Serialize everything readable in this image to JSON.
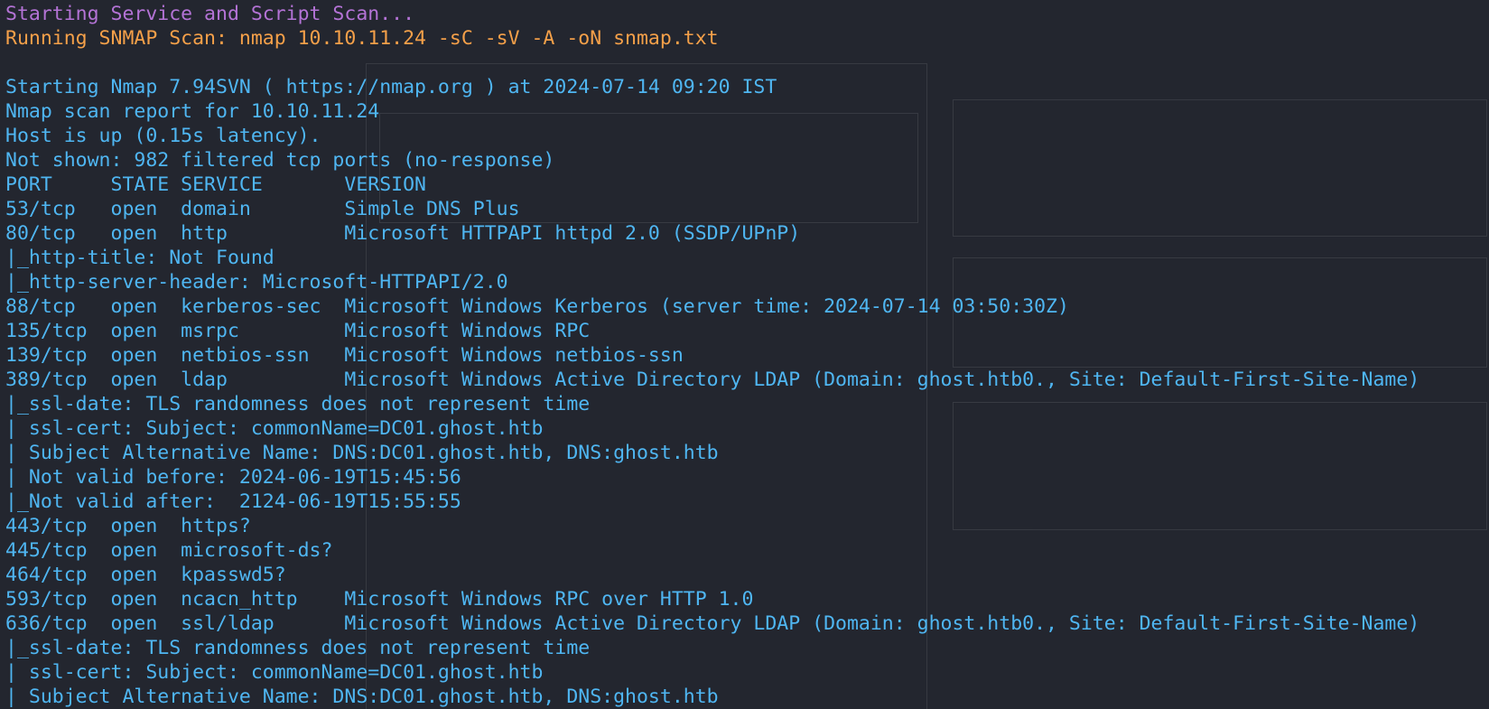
{
  "terminal": {
    "lines": [
      {
        "text": "Starting Service and Script Scan...",
        "color": "#b473d6"
      },
      {
        "text": "Running SNMAP Scan: nmap 10.10.11.24 -sC -sV -A -oN snmap.txt",
        "color": "#f5a049"
      },
      {
        "text": "",
        "color": "#4fb6f2"
      },
      {
        "text": "Starting Nmap 7.94SVN ( https://nmap.org ) at 2024-07-14 09:20 IST",
        "color": "#4fb6f2"
      },
      {
        "text": "Nmap scan report for 10.10.11.24",
        "color": "#4fb6f2"
      },
      {
        "text": "Host is up (0.15s latency).",
        "color": "#4fb6f2"
      },
      {
        "text": "Not shown: 982 filtered tcp ports (no-response)",
        "color": "#4fb6f2"
      },
      {
        "text": "PORT     STATE SERVICE       VERSION",
        "color": "#4fb6f2"
      },
      {
        "text": "53/tcp   open  domain        Simple DNS Plus",
        "color": "#4fb6f2"
      },
      {
        "text": "80/tcp   open  http          Microsoft HTTPAPI httpd 2.0 (SSDP/UPnP)",
        "color": "#4fb6f2"
      },
      {
        "text": "|_http-title: Not Found",
        "color": "#4fb6f2"
      },
      {
        "text": "|_http-server-header: Microsoft-HTTPAPI/2.0",
        "color": "#4fb6f2"
      },
      {
        "text": "88/tcp   open  kerberos-sec  Microsoft Windows Kerberos (server time: 2024-07-14 03:50:30Z)",
        "color": "#4fb6f2"
      },
      {
        "text": "135/tcp  open  msrpc         Microsoft Windows RPC",
        "color": "#4fb6f2"
      },
      {
        "text": "139/tcp  open  netbios-ssn   Microsoft Windows netbios-ssn",
        "color": "#4fb6f2"
      },
      {
        "text": "389/tcp  open  ldap          Microsoft Windows Active Directory LDAP (Domain: ghost.htb0., Site: Default-First-Site-Name)",
        "color": "#4fb6f2"
      },
      {
        "text": "|_ssl-date: TLS randomness does not represent time",
        "color": "#4fb6f2"
      },
      {
        "text": "| ssl-cert: Subject: commonName=DC01.ghost.htb",
        "color": "#4fb6f2"
      },
      {
        "text": "| Subject Alternative Name: DNS:DC01.ghost.htb, DNS:ghost.htb",
        "color": "#4fb6f2"
      },
      {
        "text": "| Not valid before: 2024-06-19T15:45:56",
        "color": "#4fb6f2"
      },
      {
        "text": "|_Not valid after:  2124-06-19T15:55:55",
        "color": "#4fb6f2"
      },
      {
        "text": "443/tcp  open  https?",
        "color": "#4fb6f2"
      },
      {
        "text": "445/tcp  open  microsoft-ds?",
        "color": "#4fb6f2"
      },
      {
        "text": "464/tcp  open  kpasswd5?",
        "color": "#4fb6f2"
      },
      {
        "text": "593/tcp  open  ncacn_http    Microsoft Windows RPC over HTTP 1.0",
        "color": "#4fb6f2"
      },
      {
        "text": "636/tcp  open  ssl/ldap      Microsoft Windows Active Directory LDAP (Domain: ghost.htb0., Site: Default-First-Site-Name)",
        "color": "#4fb6f2"
      },
      {
        "text": "|_ssl-date: TLS randomness does not represent time",
        "color": "#4fb6f2"
      },
      {
        "text": "| ssl-cert: Subject: commonName=DC01.ghost.htb",
        "color": "#4fb6f2"
      },
      {
        "text": "| Subject Alternative Name: DNS:DC01.ghost.htb, DNS:ghost.htb",
        "color": "#4fb6f2"
      }
    ]
  }
}
